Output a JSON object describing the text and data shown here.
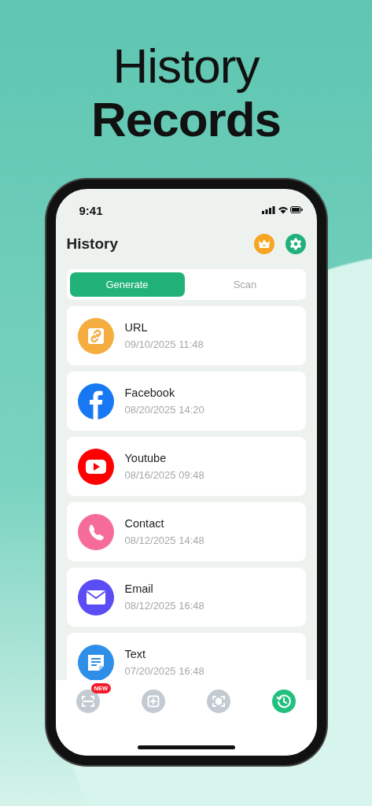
{
  "hero": {
    "line_1": "History",
    "line_2": "Records"
  },
  "status_bar": {
    "time": "9:41"
  },
  "header": {
    "title": "History"
  },
  "tabs": [
    {
      "label": "Generate",
      "selected": true
    },
    {
      "label": "Scan",
      "selected": false
    }
  ],
  "records": [
    {
      "kind": "url",
      "title": "URL",
      "date": "09/10/2025 11:48"
    },
    {
      "kind": "facebook",
      "title": "Facebook",
      "date": "08/20/2025 14:20"
    },
    {
      "kind": "youtube",
      "title": "Youtube",
      "date": "08/16/2025 09:48"
    },
    {
      "kind": "contact",
      "title": "Contact",
      "date": "08/12/2025 14:48"
    },
    {
      "kind": "email",
      "title": "Email",
      "date": "08/12/2025 16:48"
    },
    {
      "kind": "text",
      "title": "Text",
      "date": "07/20/2025 16:48"
    }
  ],
  "bottom_nav": [
    {
      "kind": "scan",
      "selected": false,
      "badge": "NEW"
    },
    {
      "kind": "create",
      "selected": false
    },
    {
      "kind": "image-scan",
      "selected": false
    },
    {
      "kind": "history",
      "selected": true
    }
  ]
}
